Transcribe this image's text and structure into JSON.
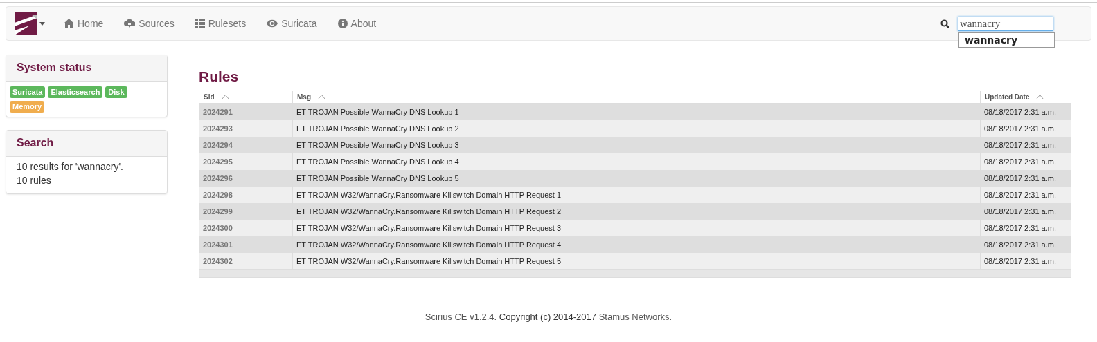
{
  "navbar": {
    "items": [
      {
        "label": "Home"
      },
      {
        "label": "Sources"
      },
      {
        "label": "Rulesets"
      },
      {
        "label": "Suricata"
      },
      {
        "label": "About"
      }
    ],
    "search": {
      "value": "wannacry",
      "suggestions": [
        "wannacry"
      ]
    }
  },
  "system_status": {
    "title": "System status",
    "badges": [
      {
        "label": "Suricata",
        "color": "#5cb85c"
      },
      {
        "label": "Elasticsearch",
        "color": "#5cb85c"
      },
      {
        "label": "Disk",
        "color": "#5cb85c"
      },
      {
        "label": "Memory",
        "color": "#f0ad4e"
      }
    ]
  },
  "search_panel": {
    "title": "Search",
    "lines": [
      "10 results for 'wannacry'.",
      "10 rules"
    ]
  },
  "rules": {
    "title": "Rules",
    "columns": [
      "Sid",
      "Msg",
      "Updated Date"
    ],
    "rows": [
      [
        "2024291",
        "ET TROJAN Possible WannaCry DNS Lookup 1",
        "08/18/2017 2:31 a.m."
      ],
      [
        "2024293",
        "ET TROJAN Possible WannaCry DNS Lookup 2",
        "08/18/2017 2:31 a.m."
      ],
      [
        "2024294",
        "ET TROJAN Possible WannaCry DNS Lookup 3",
        "08/18/2017 2:31 a.m."
      ],
      [
        "2024295",
        "ET TROJAN Possible WannaCry DNS Lookup 4",
        "08/18/2017 2:31 a.m."
      ],
      [
        "2024296",
        "ET TROJAN Possible WannaCry DNS Lookup 5",
        "08/18/2017 2:31 a.m."
      ],
      [
        "2024298",
        "ET TROJAN W32/WannaCry.Ransomware Killswitch Domain HTTP Request 1",
        "08/18/2017 2:31 a.m."
      ],
      [
        "2024299",
        "ET TROJAN W32/WannaCry.Ransomware Killswitch Domain HTTP Request 2",
        "08/18/2017 2:31 a.m."
      ],
      [
        "2024300",
        "ET TROJAN W32/WannaCry.Ransomware Killswitch Domain HTTP Request 3",
        "08/18/2017 2:31 a.m."
      ],
      [
        "2024301",
        "ET TROJAN W32/WannaCry.Ransomware Killswitch Domain HTTP Request 4",
        "08/18/2017 2:31 a.m."
      ],
      [
        "2024302",
        "ET TROJAN W32/WannaCry.Ransomware Killswitch Domain HTTP Request 5",
        "08/18/2017 2:31 a.m."
      ]
    ]
  },
  "footer": {
    "product": "Scirius CE v1.2.4.",
    "copyright": "Copyright (c) 2014-2017",
    "company": "Stamus Networks."
  }
}
